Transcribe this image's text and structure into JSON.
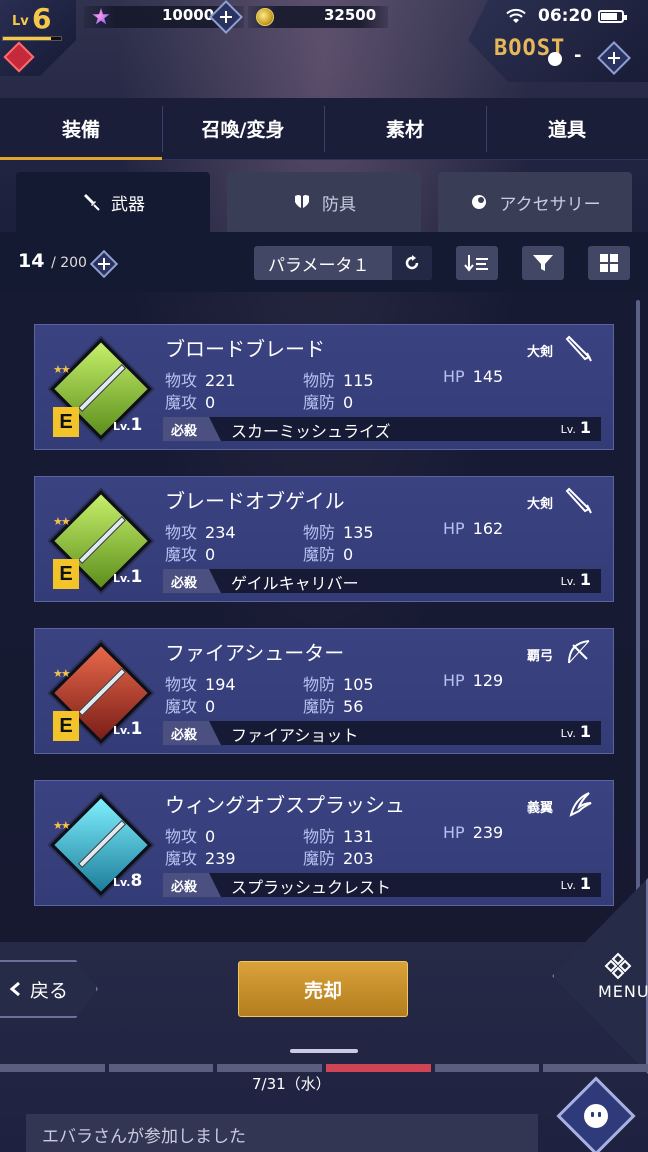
{
  "header": {
    "level_label": "Lv",
    "level": "6",
    "level_progress": 0.82,
    "gems": "10000",
    "coins": "32500",
    "time": "06:20",
    "boost_label": "BOOST",
    "boost_minus": "-"
  },
  "main_tabs": [
    {
      "label": "装備",
      "active": true
    },
    {
      "label": "召喚/変身",
      "active": false
    },
    {
      "label": "素材",
      "active": false
    },
    {
      "label": "道具",
      "active": false
    }
  ],
  "sub_tabs": [
    {
      "label": "武器",
      "icon": "sword-icon",
      "active": true
    },
    {
      "label": "防具",
      "icon": "armor-icon",
      "active": false
    },
    {
      "label": "アクセサリー",
      "icon": "accessory-icon",
      "active": false
    }
  ],
  "toolbar": {
    "count": "14",
    "count_max": "/ 200",
    "param_label": "パラメータ１"
  },
  "stat_labels": {
    "patk": "物攻",
    "matk": "魔攻",
    "pdef": "物防",
    "mdef": "魔防",
    "hp": "HP",
    "skill": "必殺",
    "lv": "Lv."
  },
  "items": [
    {
      "name": "ブロードブレード",
      "type": "大剣",
      "rank": "E",
      "level": "1",
      "patk": "221",
      "matk": "0",
      "pdef": "115",
      "mdef": "0",
      "hp": "145",
      "skill": "スカーミッシュライズ",
      "skill_lv": "1",
      "color": "green"
    },
    {
      "name": "ブレードオブゲイル",
      "type": "大剣",
      "rank": "E",
      "level": "1",
      "patk": "234",
      "matk": "0",
      "pdef": "135",
      "mdef": "0",
      "hp": "162",
      "skill": "ゲイルキャリバー",
      "skill_lv": "1",
      "color": "green"
    },
    {
      "name": "ファイアシューター",
      "type": "覇弓",
      "rank": "E",
      "level": "1",
      "patk": "194",
      "matk": "0",
      "pdef": "105",
      "mdef": "56",
      "hp": "129",
      "skill": "ファイアショット",
      "skill_lv": "1",
      "color": "red"
    },
    {
      "name": "ウィングオブスプラッシュ",
      "type": "義翼",
      "rank": "",
      "level": "8",
      "patk": "0",
      "matk": "239",
      "pdef": "131",
      "mdef": "203",
      "hp": "239",
      "skill": "スプラッシュクレスト",
      "skill_lv": "1",
      "color": "blue"
    }
  ],
  "bottom": {
    "back_label": "戻る",
    "sell_label": "売却",
    "menu_label": "MENU",
    "date": "7/31（水）",
    "chat_message": "エバラさんが参加しました"
  }
}
